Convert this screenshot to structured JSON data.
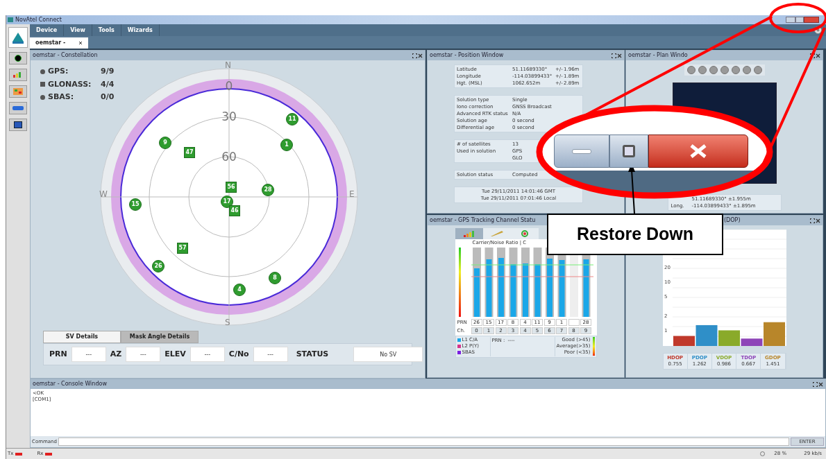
{
  "app_window": {
    "title": "NovAtel Connect"
  },
  "menu": [
    "Device",
    "View",
    "Tools",
    "Wizards"
  ],
  "doc_tabs": [
    {
      "label": "oemstar -",
      "selected": true
    }
  ],
  "constellation": {
    "title": "oemstar - Constellation",
    "legend": [
      {
        "kind": "circle",
        "label": "GPS:",
        "count": "9/9"
      },
      {
        "kind": "square",
        "label": "GLONASS:",
        "count": "4/4"
      },
      {
        "kind": "circle",
        "label": "SBAS:",
        "count": "0/0"
      }
    ],
    "compass": [
      "N",
      "E",
      "S",
      "W"
    ],
    "rings": [
      "0",
      "30",
      "60"
    ],
    "satellites": [
      {
        "prn": "11",
        "kind": "gps"
      },
      {
        "prn": "9",
        "kind": "gps"
      },
      {
        "prn": "1",
        "kind": "gps"
      },
      {
        "prn": "47",
        "kind": "glonass"
      },
      {
        "prn": "56",
        "kind": "glonass"
      },
      {
        "prn": "28",
        "kind": "gps"
      },
      {
        "prn": "17",
        "kind": "gps"
      },
      {
        "prn": "15",
        "kind": "gps"
      },
      {
        "prn": "46",
        "kind": "glonass"
      },
      {
        "prn": "57",
        "kind": "glonass"
      },
      {
        "prn": "26",
        "kind": "gps"
      },
      {
        "prn": "8",
        "kind": "gps"
      },
      {
        "prn": "4",
        "kind": "gps"
      }
    ],
    "detail_tabs": [
      {
        "label": "SV Details",
        "selected": true
      },
      {
        "label": "Mask Angle Details",
        "selected": false
      }
    ],
    "fields": [
      {
        "label": "PRN",
        "value": "---"
      },
      {
        "label": "AZ",
        "value": "---"
      },
      {
        "label": "ELEV",
        "value": "---"
      },
      {
        "label": "C/No",
        "value": "---"
      },
      {
        "label": "STATUS",
        "value": "No SV"
      }
    ]
  },
  "position": {
    "title": "oemstar - Position Window",
    "groups": [
      [
        {
          "label": "Latitude",
          "value": "51.11689330°",
          "pm": "+/-",
          "err": "1.96m"
        },
        {
          "label": "Longitude",
          "value": "-114.03899433°",
          "pm": "+/-",
          "err": "1.89m"
        },
        {
          "label": "Hgt. (MSL)",
          "value": "1062.652m",
          "pm": "+/-",
          "err": "2.89m"
        }
      ],
      [
        {
          "label": "Solution type",
          "value": "Single"
        },
        {
          "label": "Iono correction",
          "value": "GNSS Broadcast"
        },
        {
          "label": "Advanced RTK status",
          "value": "N/A"
        },
        {
          "label": "Solution age",
          "value": "0 second"
        },
        {
          "label": "Differential age",
          "value": "0 second"
        }
      ],
      [
        {
          "label": "# of satellites",
          "value": "13"
        },
        {
          "label": "Used in solution",
          "value": "GPS"
        },
        {
          "value": "GLO"
        }
      ],
      [
        {
          "label": "Solution status",
          "value": "Computed"
        }
      ]
    ],
    "times": [
      "Tue 29/11/2011 14:01:46 GMT",
      "Tue 29/11/2011 07:01:46 Local"
    ]
  },
  "plan": {
    "title": "oemstar - Plan Windo",
    "coords": [
      {
        "value": "51.11689330° ±1.955m"
      },
      {
        "label": "Long.",
        "value": "-114.03899433° ±1.895m"
      }
    ]
  },
  "tracking": {
    "title": "oemstar - GPS Tracking Channel Statu",
    "chart_title": "Carrier/Noise Ratio | C",
    "prn_label": "PRN",
    "ch_label": "Ch.",
    "channels": [
      {
        "prn": "26",
        "ch": "0"
      },
      {
        "prn": "15",
        "ch": "1"
      },
      {
        "prn": "17",
        "ch": "2"
      },
      {
        "prn": "8",
        "ch": "3"
      },
      {
        "prn": "4",
        "ch": "4"
      },
      {
        "prn": "11",
        "ch": "5"
      },
      {
        "prn": "9",
        "ch": "6"
      },
      {
        "prn": "1",
        "ch": "7"
      },
      {
        "ch": "8"
      },
      {
        "prn": "28",
        "ch": "9"
      }
    ],
    "legend": [
      {
        "label": "L1 C/A",
        "color": "#1aa7e8"
      },
      {
        "label": "L2 P(Y)",
        "color": "#d6338a"
      },
      {
        "label": "SBAS",
        "color": "#7a1fe0"
      }
    ],
    "prn_info": "PRN :",
    "prn_value": "----",
    "quality": [
      "Good (>45)",
      "Average(>35)",
      "Poor (<35)"
    ]
  },
  "dop": {
    "title": "(DOP)",
    "axis_labels": [
      "20",
      "10",
      "5",
      "2",
      "1"
    ],
    "readouts": [
      {
        "label": "HDOP",
        "value": "0.755",
        "color": "#c0392b"
      },
      {
        "label": "PDOP",
        "value": "1.262",
        "color": "#2f8fc8"
      },
      {
        "label": "VDOP",
        "value": "0.986",
        "color": "#8aaa2a"
      },
      {
        "label": "TDOP",
        "value": "0.667",
        "color": "#8e44b8"
      },
      {
        "label": "GDOP",
        "value": "1.451",
        "color": "#b8862a"
      }
    ]
  },
  "console": {
    "title": "oemstar - Console Window",
    "lines": [
      "<OK",
      "[COM1]"
    ],
    "command_label": "Command",
    "enter": "ENTER"
  },
  "status_bar": {
    "tx": "Tx",
    "rx": "Rx",
    "load": "28 %",
    "rate": "29 kb/s"
  },
  "callout": {
    "label": "Restore Down"
  }
}
